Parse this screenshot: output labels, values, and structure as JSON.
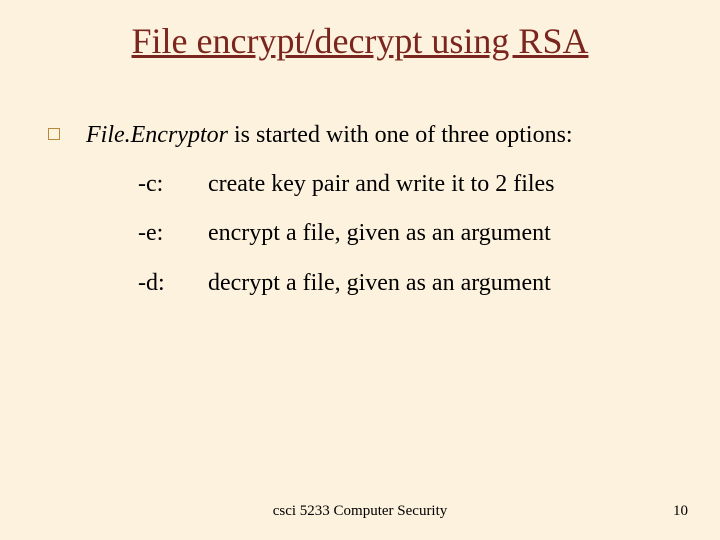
{
  "title": "File encrypt/decrypt using RSA",
  "lead": {
    "program": "File.Encryptor",
    "rest": " is started with one of three options:"
  },
  "options": [
    {
      "flag": "-c:",
      "desc": "create key pair and write it to 2 files"
    },
    {
      "flag": "-e:",
      "desc": "encrypt a file, given as an argument"
    },
    {
      "flag": "-d:",
      "desc": "decrypt a file, given as an argument"
    }
  ],
  "footer": {
    "center": "csci 5233 Computer Security",
    "page": "10"
  }
}
